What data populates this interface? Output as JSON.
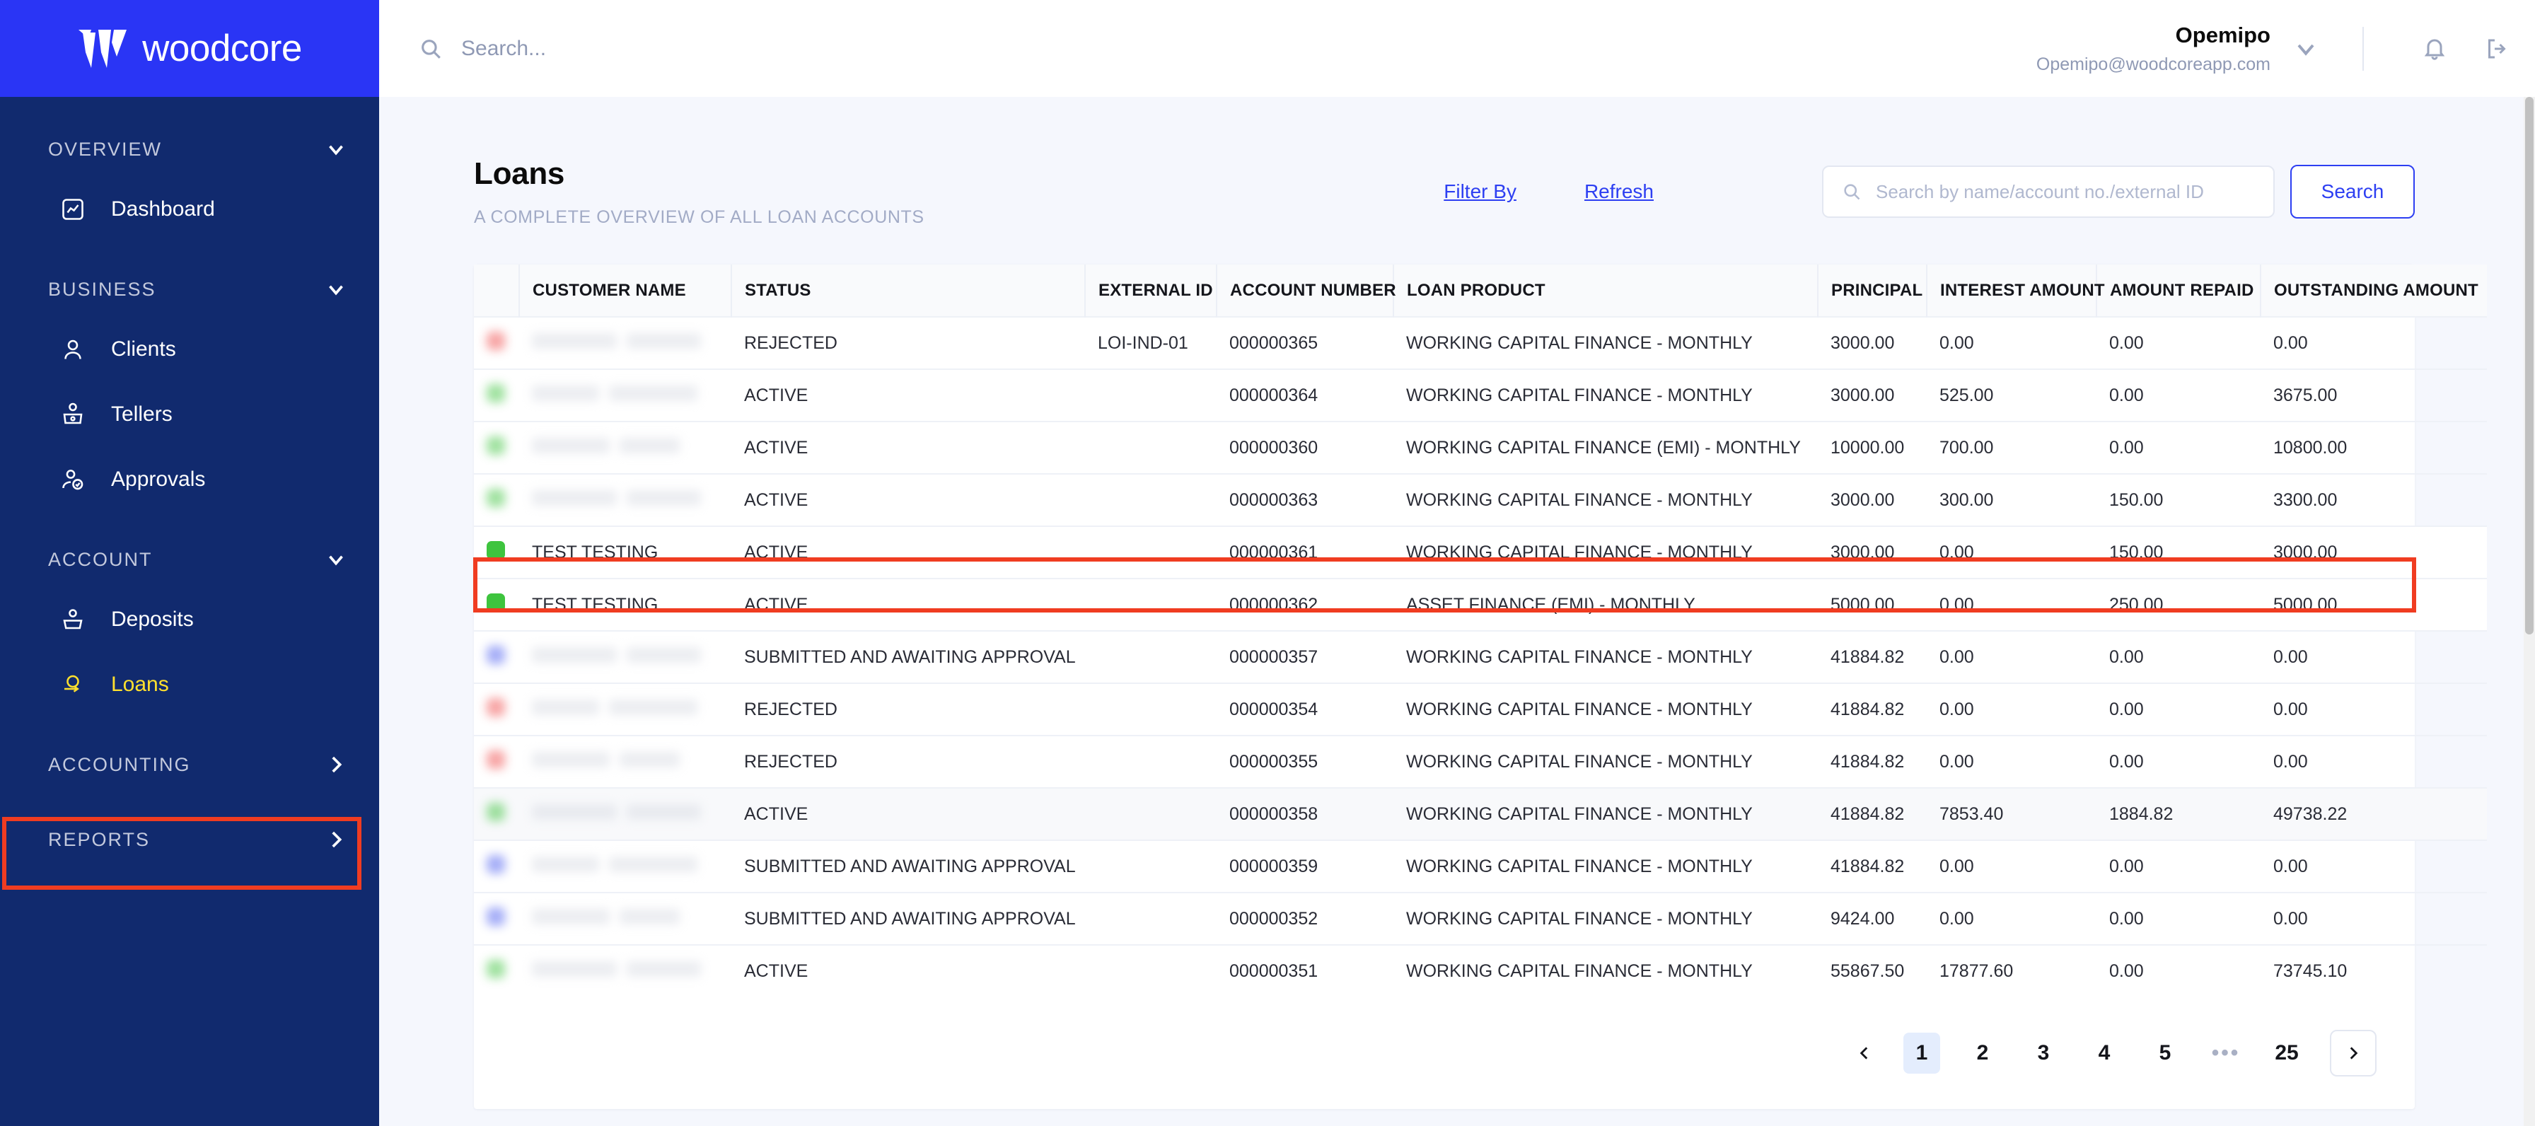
{
  "brand": {
    "name": "woodcore",
    "logo_icon": "woodcore-w-mark",
    "header_bg": "#2a35f5",
    "sidebar_bg": "#112a6e",
    "active_color": "#ffe02e"
  },
  "sidebar": {
    "sections": [
      {
        "label": "OVERVIEW",
        "chevron": "chevron-down-icon"
      },
      {
        "label": "BUSINESS",
        "chevron": "chevron-down-icon"
      },
      {
        "label": "ACCOUNT",
        "chevron": "chevron-down-icon"
      },
      {
        "label": "ACCOUNTING",
        "chevron": "chevron-right-icon"
      },
      {
        "label": "REPORTS",
        "chevron": "chevron-right-icon"
      }
    ],
    "items": {
      "dashboard": "Dashboard",
      "clients": "Clients",
      "tellers": "Tellers",
      "approvals": "Approvals",
      "deposits": "Deposits",
      "loans": "Loans"
    },
    "active_item": "Loans"
  },
  "topbar": {
    "search_placeholder": "Search...",
    "search_icon": "search-icon",
    "user_name": "Opemipo",
    "user_email": "Opemipo@woodcoreapp.com",
    "chevron_icon": "chevron-down-icon",
    "bell_icon": "bell-icon",
    "logout_icon": "logout-icon"
  },
  "page": {
    "title": "Loans",
    "subtitle": "A COMPLETE OVERVIEW OF ALL LOAN ACCOUNTS",
    "filter_by": "Filter By",
    "refresh": "Refresh",
    "search_placeholder": "Search by name/account no./external ID",
    "search_value": "",
    "search_button": "Search"
  },
  "table": {
    "columns": [
      "CUSTOMER NAME",
      "STATUS",
      "EXTERNAL ID",
      "ACCOUNT NUMBER",
      "LOAN PRODUCT",
      "PRINCIPAL",
      "INTEREST AMOUNT",
      "AMOUNT REPAID",
      "OUTSTANDING AMOUNT"
    ],
    "rows": [
      {
        "dot": "red",
        "name": "",
        "redacted": true,
        "status": "REJECTED",
        "external_id": "LOI-IND-01",
        "account_number": "000000365",
        "product": "WORKING CAPITAL FINANCE - MONTHLY",
        "principal": "3000.00",
        "interest": "0.00",
        "repaid": "0.00",
        "outstanding": "0.00",
        "shade": false,
        "highlighted": false
      },
      {
        "dot": "green",
        "name": "",
        "redacted": true,
        "status": "ACTIVE",
        "external_id": "",
        "account_number": "000000364",
        "product": "WORKING CAPITAL FINANCE - MONTHLY",
        "principal": "3000.00",
        "interest": "525.00",
        "repaid": "0.00",
        "outstanding": "3675.00",
        "shade": false,
        "highlighted": false
      },
      {
        "dot": "green",
        "name": "",
        "redacted": true,
        "status": "ACTIVE",
        "external_id": "",
        "account_number": "000000360",
        "product": "WORKING CAPITAL FINANCE (EMI) - MONTHLY",
        "principal": "10000.00",
        "interest": "700.00",
        "repaid": "0.00",
        "outstanding": "10800.00",
        "shade": false,
        "highlighted": false
      },
      {
        "dot": "green",
        "name": "",
        "redacted": true,
        "status": "ACTIVE",
        "external_id": "",
        "account_number": "000000363",
        "product": "WORKING CAPITAL FINANCE - MONTHLY",
        "principal": "3000.00",
        "interest": "300.00",
        "repaid": "150.00",
        "outstanding": "3300.00",
        "shade": false,
        "highlighted": false
      },
      {
        "dot": "green",
        "name": "TEST TESTING",
        "redacted": false,
        "status": "ACTIVE",
        "external_id": "",
        "account_number": "000000361",
        "product": "WORKING CAPITAL FINANCE - MONTHLY",
        "principal": "3000.00",
        "interest": "0.00",
        "repaid": "150.00",
        "outstanding": "3000.00",
        "shade": false,
        "highlighted": true
      },
      {
        "dot": "green",
        "name": "TEST TESTING",
        "redacted": false,
        "status": "ACTIVE",
        "external_id": "",
        "account_number": "000000362",
        "product": "ASSET FINANCE (EMI) - MONTHLY",
        "principal": "5000.00",
        "interest": "0.00",
        "repaid": "250.00",
        "outstanding": "5000.00",
        "shade": false,
        "highlighted": true
      },
      {
        "dot": "purple",
        "name": "",
        "redacted": true,
        "status": "SUBMITTED AND AWAITING APPROVAL",
        "external_id": "",
        "account_number": "000000357",
        "product": "WORKING CAPITAL FINANCE - MONTHLY",
        "principal": "41884.82",
        "interest": "0.00",
        "repaid": "0.00",
        "outstanding": "0.00",
        "shade": false,
        "highlighted": false
      },
      {
        "dot": "red",
        "name": "",
        "redacted": true,
        "status": "REJECTED",
        "external_id": "",
        "account_number": "000000354",
        "product": "WORKING CAPITAL FINANCE - MONTHLY",
        "principal": "41884.82",
        "interest": "0.00",
        "repaid": "0.00",
        "outstanding": "0.00",
        "shade": false,
        "highlighted": false
      },
      {
        "dot": "red",
        "name": "",
        "redacted": true,
        "status": "REJECTED",
        "external_id": "",
        "account_number": "000000355",
        "product": "WORKING CAPITAL FINANCE - MONTHLY",
        "principal": "41884.82",
        "interest": "0.00",
        "repaid": "0.00",
        "outstanding": "0.00",
        "shade": false,
        "highlighted": false
      },
      {
        "dot": "green",
        "name": "",
        "redacted": true,
        "status": "ACTIVE",
        "external_id": "",
        "account_number": "000000358",
        "product": "WORKING CAPITAL FINANCE - MONTHLY",
        "principal": "41884.82",
        "interest": "7853.40",
        "repaid": "1884.82",
        "outstanding": "49738.22",
        "shade": true,
        "highlighted": false
      },
      {
        "dot": "purple",
        "name": "",
        "redacted": true,
        "status": "SUBMITTED AND AWAITING APPROVAL",
        "external_id": "",
        "account_number": "000000359",
        "product": "WORKING CAPITAL FINANCE - MONTHLY",
        "principal": "41884.82",
        "interest": "0.00",
        "repaid": "0.00",
        "outstanding": "0.00",
        "shade": false,
        "highlighted": false
      },
      {
        "dot": "purple",
        "name": "",
        "redacted": true,
        "status": "SUBMITTED AND AWAITING APPROVAL",
        "external_id": "",
        "account_number": "000000352",
        "product": "WORKING CAPITAL FINANCE - MONTHLY",
        "principal": "9424.00",
        "interest": "0.00",
        "repaid": "0.00",
        "outstanding": "0.00",
        "shade": false,
        "highlighted": false
      },
      {
        "dot": "green",
        "name": "",
        "redacted": true,
        "status": "ACTIVE",
        "external_id": "",
        "account_number": "000000351",
        "product": "WORKING CAPITAL FINANCE - MONTHLY",
        "principal": "55867.50",
        "interest": "17877.60",
        "repaid": "0.00",
        "outstanding": "73745.10",
        "shade": false,
        "highlighted": false
      }
    ]
  },
  "pagination": {
    "prev_icon": "chevron-left-icon",
    "next_icon": "chevron-right-icon",
    "pages": [
      "1",
      "2",
      "3",
      "4",
      "5",
      "•••",
      "25"
    ],
    "current": "1"
  },
  "annotation": {
    "color": "#f03c21"
  }
}
